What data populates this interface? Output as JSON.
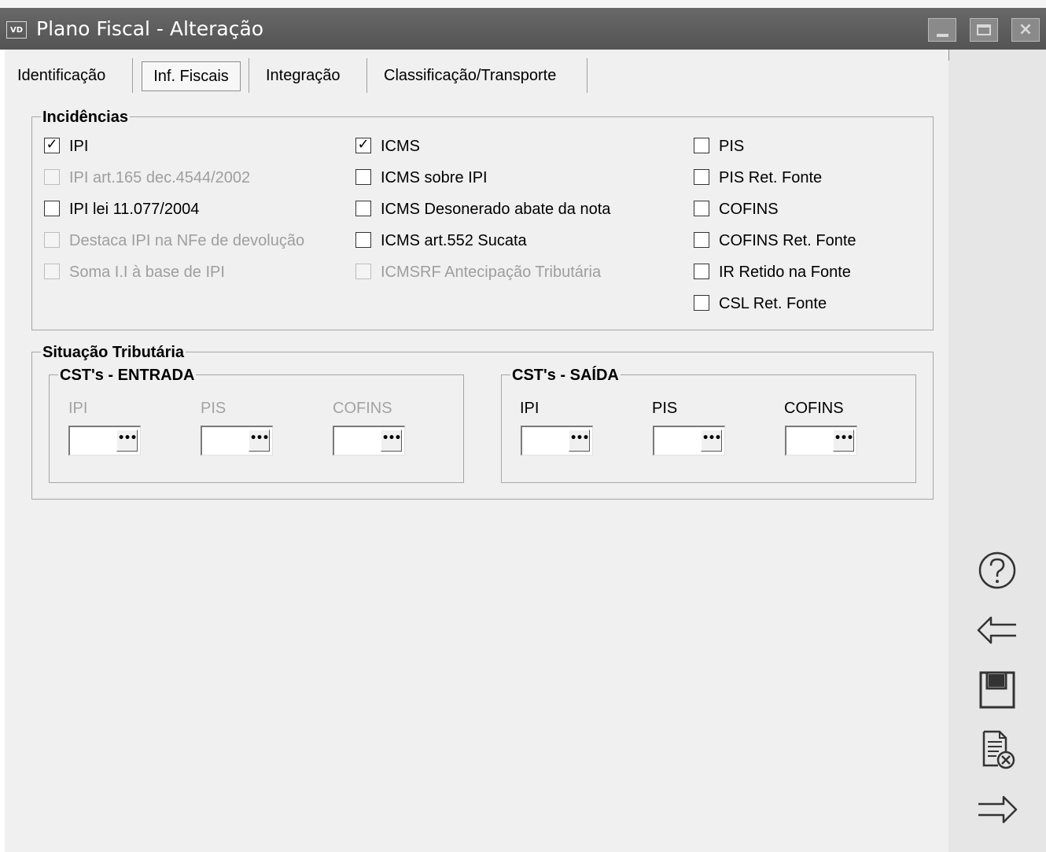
{
  "window": {
    "app_icon": "VD",
    "title": "Plano Fiscal - Alteração",
    "buttons": {
      "minimize": "minimize-icon",
      "maximize": "maximize-icon",
      "close": "×"
    }
  },
  "tabs": [
    {
      "label": "Identificação",
      "active": false
    },
    {
      "label": "Inf. Fiscais",
      "active": true
    },
    {
      "label": "Integração",
      "active": false
    },
    {
      "label": "Classificação/Transporte",
      "active": false
    }
  ],
  "incidencias": {
    "title": "Incidências",
    "col1": [
      {
        "label": "IPI",
        "checked": true,
        "enabled": true
      },
      {
        "label": "IPI art.165 dec.4544/2002",
        "checked": false,
        "enabled": false
      },
      {
        "label": "IPI lei 11.077/2004",
        "checked": false,
        "enabled": true
      },
      {
        "label": "Destaca IPI na NFe de devolução",
        "checked": false,
        "enabled": false
      },
      {
        "label": "Soma I.I à base de IPI",
        "checked": false,
        "enabled": false
      }
    ],
    "col2": [
      {
        "label": "ICMS",
        "checked": true,
        "enabled": true
      },
      {
        "label": "ICMS sobre IPI",
        "checked": false,
        "enabled": true
      },
      {
        "label": "ICMS Desonerado abate da nota",
        "checked": false,
        "enabled": true
      },
      {
        "label": "ICMS art.552 Sucata",
        "checked": false,
        "enabled": true
      },
      {
        "label": "ICMSRF Antecipação Tributária",
        "checked": false,
        "enabled": false
      }
    ],
    "col3": [
      {
        "label": "PIS",
        "checked": false,
        "enabled": true
      },
      {
        "label": "PIS Ret. Fonte",
        "checked": false,
        "enabled": true
      },
      {
        "label": "COFINS",
        "checked": false,
        "enabled": true
      },
      {
        "label": "COFINS Ret. Fonte",
        "checked": false,
        "enabled": true
      },
      {
        "label": "IR Retido na Fonte",
        "checked": false,
        "enabled": true
      },
      {
        "label": "CSL Ret. Fonte",
        "checked": false,
        "enabled": true
      }
    ]
  },
  "situacao": {
    "title": "Situação Tributária",
    "entrada": {
      "title": "CST's - ENTRADA",
      "fields": [
        {
          "label": "IPI",
          "value": "",
          "enabled": false
        },
        {
          "label": "PIS",
          "value": "",
          "enabled": false
        },
        {
          "label": "COFINS",
          "value": "",
          "enabled": false
        }
      ]
    },
    "saida": {
      "title": "CST's - SAÍDA",
      "fields": [
        {
          "label": "IPI",
          "value": "",
          "enabled": true
        },
        {
          "label": "PIS",
          "value": "",
          "enabled": true
        },
        {
          "label": "COFINS",
          "value": "",
          "enabled": true
        }
      ]
    },
    "ellipsis": "•••",
    "checkmark": "✓"
  },
  "side_actions": [
    {
      "name": "help-icon",
      "glyph": "?"
    },
    {
      "name": "back-arrow-icon",
      "glyph": "⇐"
    },
    {
      "name": "save-icon",
      "glyph": "floppy"
    },
    {
      "name": "cancel-document-icon",
      "glyph": "doc-x"
    },
    {
      "name": "forward-arrow-icon",
      "glyph": "⇒"
    }
  ]
}
